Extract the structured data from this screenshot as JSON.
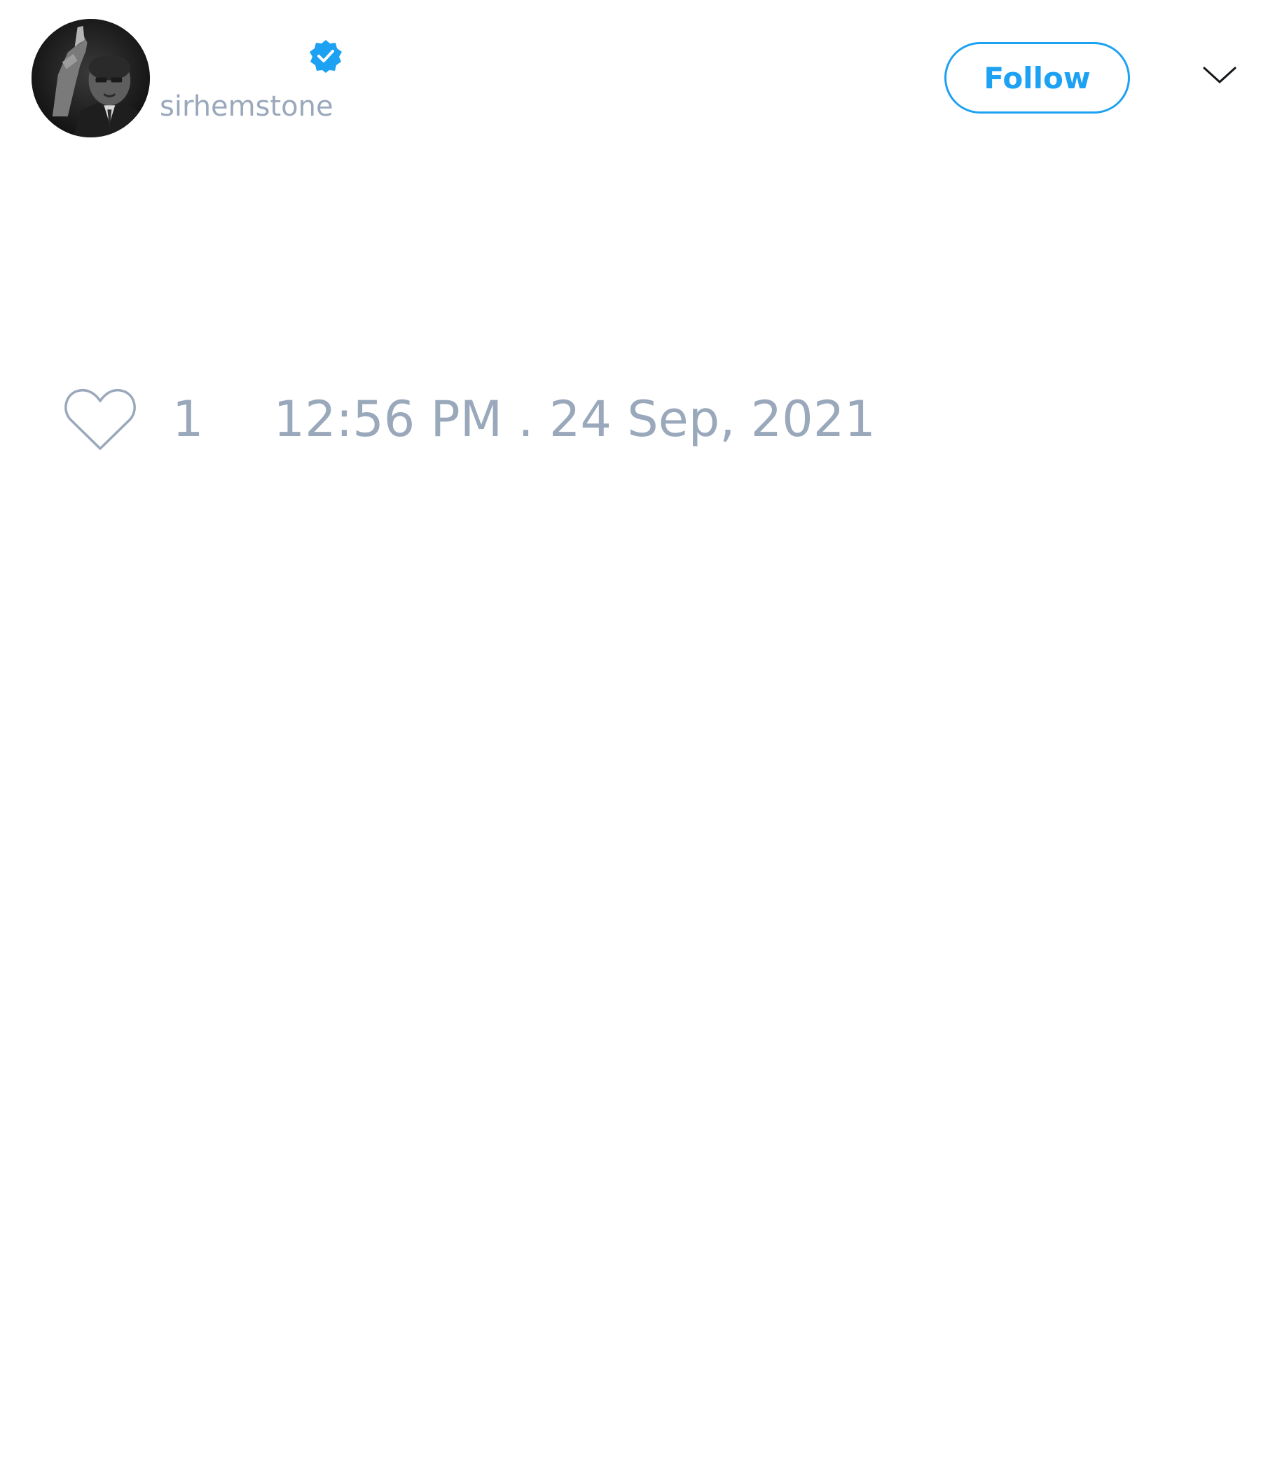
{
  "tweet": {
    "author": {
      "display_name": "",
      "handle": "sirhemstone",
      "verified": true,
      "avatar_icon": "profile-photo"
    },
    "follow_label": "Follow",
    "menu_icon": "chevron-down-icon",
    "text": "",
    "likes": {
      "icon": "heart-icon",
      "count": "1"
    },
    "timestamp": "12:56 PM . 24 Sep, 2021"
  },
  "colors": {
    "accent": "#1da1f2",
    "muted_text": "#9aa8bb",
    "background": "#ffffff"
  }
}
